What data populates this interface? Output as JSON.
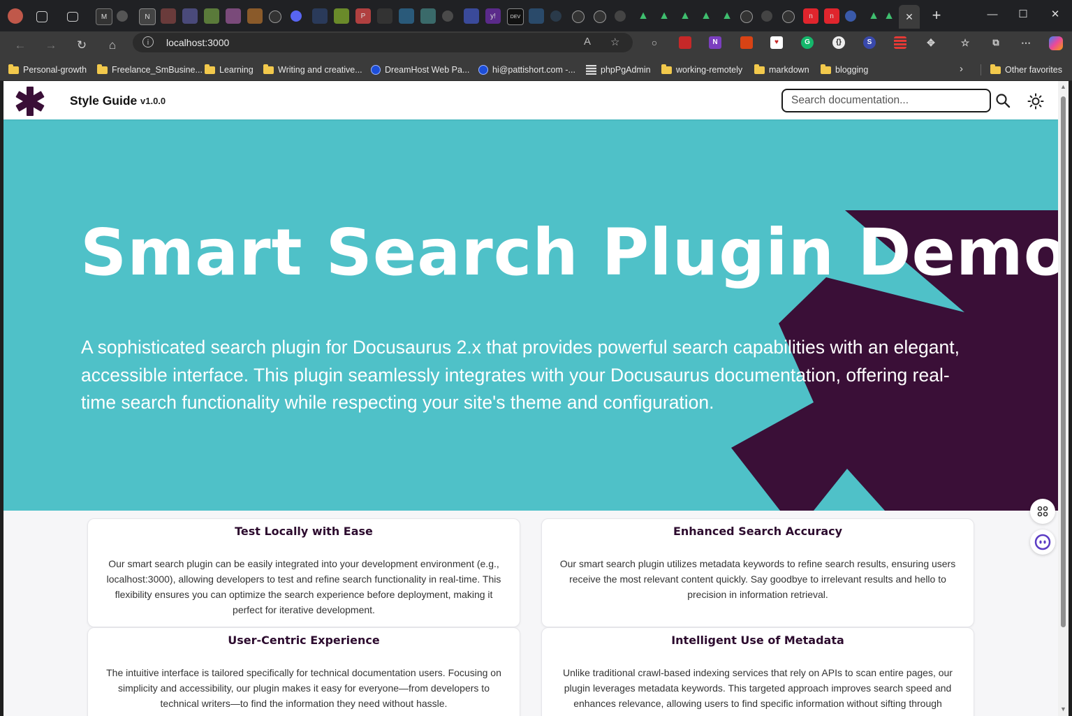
{
  "browser": {
    "tab_close": "✕",
    "new_tab": "+",
    "window": {
      "minimize": "—",
      "maximize": "☐",
      "close": "✕"
    },
    "url": "localhost:3000",
    "read_aloud": "A",
    "bookmarks": [
      {
        "label": "Personal-growth",
        "icon": "folder"
      },
      {
        "label": "Freelance_SmBusine...",
        "icon": "folder"
      },
      {
        "label": "Learning",
        "icon": "folder"
      },
      {
        "label": "Writing and creative...",
        "icon": "folder"
      },
      {
        "label": "DreamHost Web Pa...",
        "icon": "globe"
      },
      {
        "label": "hi@pattishort.com -...",
        "icon": "globe"
      },
      {
        "label": "phpPgAdmin",
        "icon": "pg"
      },
      {
        "label": "working-remotely",
        "icon": "folder"
      },
      {
        "label": "markdown",
        "icon": "folder"
      },
      {
        "label": "blogging",
        "icon": "folder"
      }
    ],
    "other_favorites": "Other favorites"
  },
  "site": {
    "title": "Style Guide",
    "version": "v1.0.0",
    "search_placeholder": "Search documentation...",
    "accent_color": "#4fc1c8",
    "brand_dark": "#3a0f37"
  },
  "hero": {
    "title": "Smart Search Plugin Demo",
    "description": "A sophisticated search plugin for Docusaurus 2.x that provides powerful search capabilities with an elegant, accessible interface. This plugin seamlessly integrates with your Docusaurus documentation, offering real-time search functionality while respecting your site's theme and configuration."
  },
  "features": [
    {
      "title": "Test Locally with Ease",
      "body": "Our smart search plugin can be easily integrated into your development environment (e.g., localhost:3000), allowing developers to test and refine search functionality in real-time. This flexibility ensures you can optimize the search experience before deployment, making it perfect for iterative development."
    },
    {
      "title": "Enhanced Search Accuracy",
      "body": "Our smart search plugin utilizes metadata keywords to refine search results, ensuring users receive the most relevant content quickly. Say goodbye to irrelevant results and hello to precision in information retrieval."
    },
    {
      "title": "User-Centric Experience",
      "body": "The intuitive interface is tailored specifically for technical documentation users. Focusing on simplicity and accessibility, our plugin makes it easy for everyone—from developers to technical writers—to find the information they need without hassle."
    },
    {
      "title": "Intelligent Use of Metadata",
      "body": "Unlike traditional crawl-based indexing services that rely on APIs to scan entire pages, our plugin leverages metadata keywords. This targeted approach improves search speed and enhances relevance, allowing users to find specific information without sifting through"
    }
  ]
}
